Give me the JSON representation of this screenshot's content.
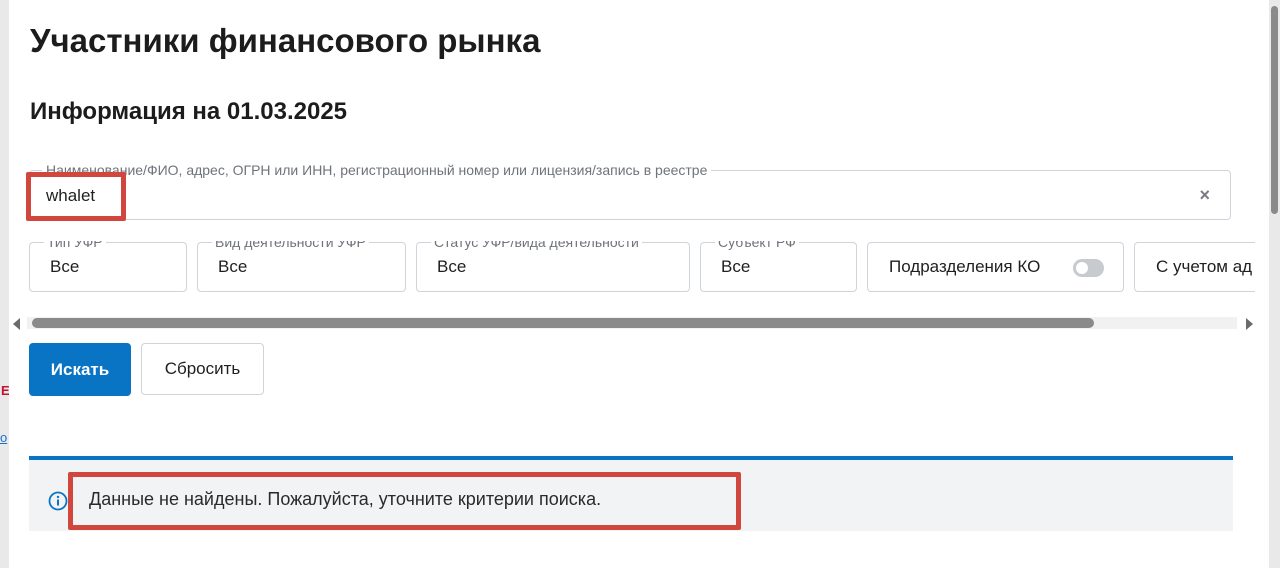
{
  "header": {
    "title": "Участники финансового рынка",
    "subtitle": "Информация на 01.03.2025"
  },
  "search": {
    "label": "Наименование/ФИО, адрес, ОГРН или ИНН, регистрационный номер или лицензия/запись в реестре",
    "value": "whalet",
    "clear_icon": "close-icon",
    "clear_glyph": "×"
  },
  "filters": {
    "type": {
      "label": "Тип УФР",
      "value": "Все"
    },
    "activity": {
      "label": "Вид деятельности УФР",
      "value": "Все"
    },
    "status": {
      "label": "Статус УФР/вида деятельности",
      "value": "Все"
    },
    "region": {
      "label": "Субъект РФ",
      "value": "Все"
    },
    "branches": {
      "label": "Подразделения КО",
      "enabled": false
    },
    "extra": {
      "label": "С учетом ад"
    }
  },
  "scrollbar": {
    "visible_fraction": 0.885,
    "position": 0
  },
  "buttons": {
    "search_label": "Искать",
    "reset_label": "Сбросить"
  },
  "notice": {
    "icon": "info-icon",
    "message": "Данные не найдены. Пожалуйста, уточните критерии поиска."
  },
  "colors": {
    "primary": "#0a74c4",
    "annotation": "#d2473d",
    "notice_bg": "#f2f3f4"
  }
}
